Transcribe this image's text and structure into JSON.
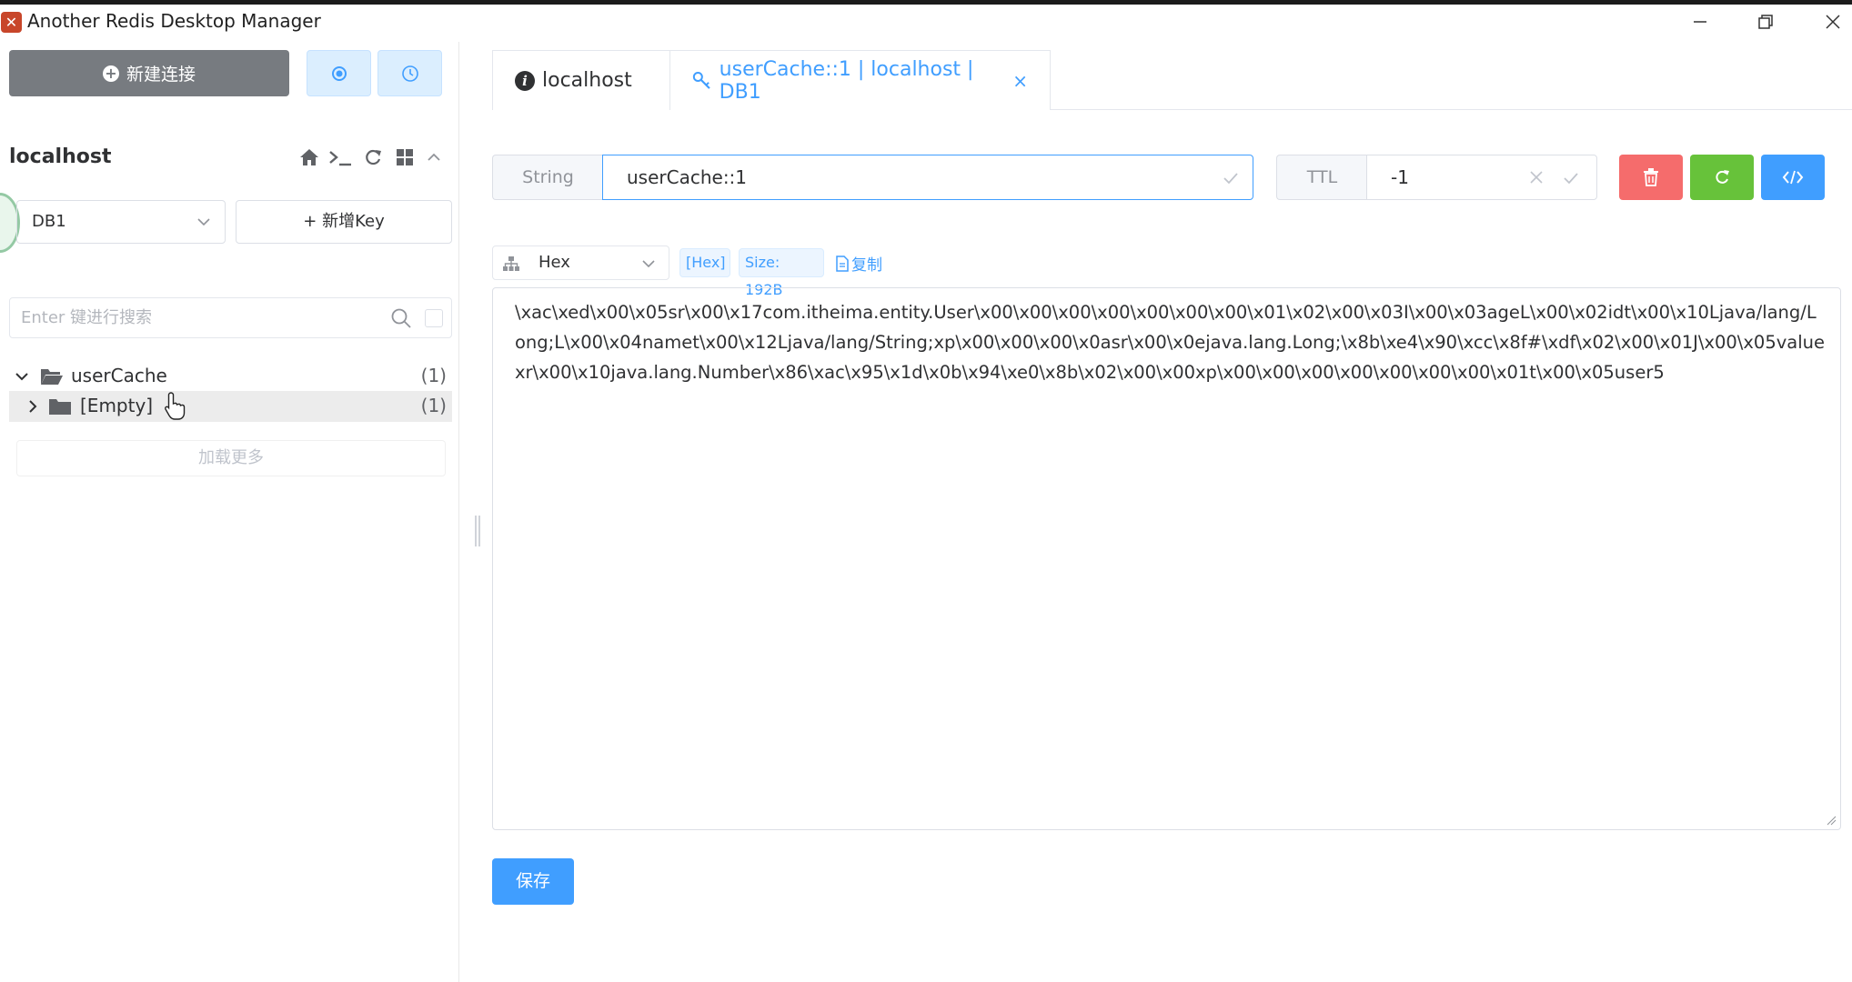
{
  "window": {
    "title": "Another Redis Desktop Manager",
    "app_icon_glyph": "✕",
    "controls": [
      "minimize-icon",
      "restore-icon",
      "close-icon"
    ]
  },
  "sidebar": {
    "new_connection_label": "新建连接",
    "connection_name": "localhost",
    "db_select_value": "DB1",
    "new_key_label": "+ 新增Key",
    "search_placeholder": "Enter 键进行搜索",
    "tree": [
      {
        "label": "userCache",
        "count": "(1)",
        "expanded": true
      },
      {
        "label": "[Empty]",
        "count": "(1)",
        "expanded": false
      }
    ],
    "load_more_label": "加载更多"
  },
  "tabs": [
    {
      "label": "localhost",
      "icon": "info-icon",
      "active": false
    },
    {
      "label": "userCache::1 | localhost | DB1",
      "icon": "key-icon",
      "active": true,
      "close": "×"
    }
  ],
  "key_editor": {
    "type_label": "String",
    "key_name": "userCache::1",
    "ttl_label": "TTL",
    "ttl_value": "-1"
  },
  "value_view": {
    "format_value": "Hex",
    "hex_tag": "[Hex]",
    "size_tag": "Size: 192B",
    "copy_label": "复制",
    "content": "\\xac\\xed\\x00\\x05sr\\x00\\x17com.itheima.entity.User\\x00\\x00\\x00\\x00\\x00\\x00\\x00\\x01\\x02\\x00\\x03I\\x00\\x03ageL\\x00\\x02idt\\x00\\x10Ljava/lang/Long;L\\x00\\x04namet\\x00\\x12Ljava/lang/String;xp\\x00\\x00\\x00\\x0asr\\x00\\x0ejava.lang.Long;\\x8b\\xe4\\x90\\xcc\\x8f#\\xdf\\x02\\x00\\x01J\\x00\\x05valuexr\\x00\\x10java.lang.Number\\x86\\xac\\x95\\x1d\\x0b\\x94\\xe0\\x8b\\x02\\x00\\x00xp\\x00\\x00\\x00\\x00\\x00\\x00\\x00\\x01t\\x00\\x05user5"
  },
  "save_label": "保存",
  "colors": {
    "primary": "#409eff",
    "danger": "#f56c6c",
    "success": "#67c23a",
    "sidebar_button": "#777b80"
  }
}
